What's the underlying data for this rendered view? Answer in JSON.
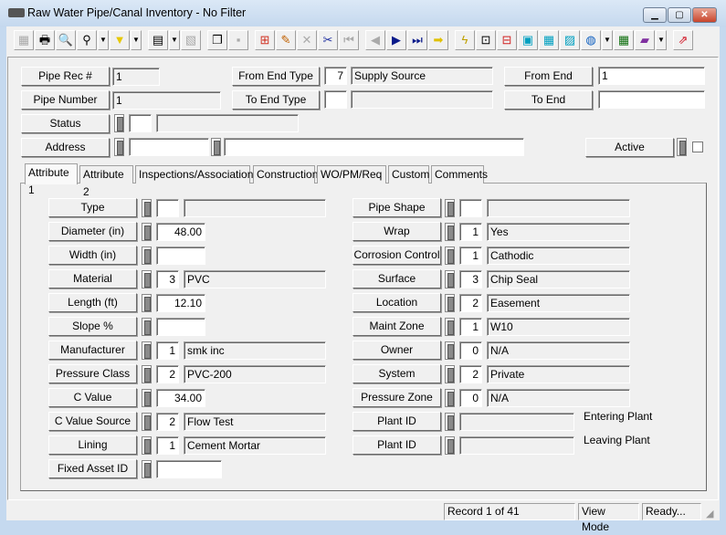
{
  "window": {
    "title": "Raw Water Pipe/Canal Inventory - No Filter",
    "minimize": "▁",
    "maximize": "▢",
    "close": "✕"
  },
  "toolbar": [
    {
      "name": "screen",
      "glyph": "▦",
      "disabled": true
    },
    {
      "name": "print",
      "glyph": "🖶"
    },
    {
      "name": "print-preview",
      "glyph": "🔍"
    },
    {
      "name": "find",
      "glyph": "⚲",
      "dd": true
    },
    {
      "name": "filter",
      "glyph": "▼",
      "color": "#e6c800",
      "dd": true
    },
    {
      "name": "report",
      "glyph": "▤",
      "dd": true
    },
    {
      "name": "form",
      "glyph": "▧",
      "disabled": true
    },
    {
      "name": "copy-record",
      "glyph": "❐"
    },
    {
      "name": "save",
      "glyph": "▪",
      "disabled": true
    },
    {
      "name": "add-record",
      "glyph": "⊞",
      "color": "#d03020"
    },
    {
      "name": "edit",
      "glyph": "✎",
      "color": "#c06000"
    },
    {
      "name": "delete",
      "glyph": "✕",
      "disabled": true
    },
    {
      "name": "cut",
      "glyph": "✂",
      "color": "#2030a0"
    },
    {
      "name": "first-record",
      "glyph": "⏮",
      "disabled": true
    },
    {
      "name": "previous-record",
      "glyph": "◀",
      "disabled": true
    },
    {
      "name": "next-record",
      "glyph": "▶",
      "color": "#0a1a8a"
    },
    {
      "name": "last-record",
      "glyph": "⏭",
      "color": "#0a1a8a"
    },
    {
      "name": "go-to",
      "glyph": "➡",
      "color": "#e0c000"
    },
    {
      "name": "lightning",
      "glyph": "ϟ",
      "color": "#c0a000"
    },
    {
      "name": "diagram",
      "glyph": "⊡"
    },
    {
      "name": "network",
      "glyph": "⊟",
      "color": "#d02020"
    },
    {
      "name": "map",
      "glyph": "▣",
      "color": "#00a0c0"
    },
    {
      "name": "calculator",
      "glyph": "▦",
      "color": "#00a0c0"
    },
    {
      "name": "parcel-map",
      "glyph": "▨",
      "color": "#00a0c0"
    },
    {
      "name": "globe",
      "glyph": "◍",
      "color": "#1060c0",
      "dd": true
    },
    {
      "name": "spreadsheet",
      "glyph": "▦",
      "color": "#107010"
    },
    {
      "name": "book",
      "glyph": "▰",
      "color": "#8030a0",
      "dd": true
    },
    {
      "name": "exit",
      "glyph": "⇗",
      "color": "#d01020"
    }
  ],
  "header": {
    "pipe_rec": {
      "label": "Pipe Rec #",
      "value": "1"
    },
    "pipe_number": {
      "label": "Pipe Number",
      "value": "1"
    },
    "status": {
      "label": "Status",
      "code": "",
      "desc": ""
    },
    "address": {
      "label": "Address",
      "number": "",
      "street": ""
    },
    "from_end_type": {
      "label": "From End Type",
      "code": "7",
      "desc": "Supply Source"
    },
    "to_end_type": {
      "label": "To End Type",
      "code": "",
      "desc": ""
    },
    "from_end": {
      "label": "From End",
      "value": "1"
    },
    "to_end": {
      "label": "To End",
      "value": ""
    },
    "active": {
      "label": "Active",
      "checked": false
    }
  },
  "tabs": [
    "Attribute 1",
    "Attribute 2",
    "Inspections/Associations",
    "Construction",
    "WO/PM/Req",
    "Custom",
    "Comments"
  ],
  "active_tab": "Attribute 1",
  "left_fields": [
    {
      "label": "Type",
      "kind": "lookup",
      "code": "",
      "desc": ""
    },
    {
      "label": "Diameter (in)",
      "kind": "number",
      "value": "48.00"
    },
    {
      "label": "Width (in)",
      "kind": "number",
      "value": ""
    },
    {
      "label": "Material",
      "kind": "lookup",
      "code": "3",
      "desc": "PVC"
    },
    {
      "label": "Length (ft)",
      "kind": "number",
      "value": "12.10"
    },
    {
      "label": "Slope %",
      "kind": "number",
      "value": ""
    },
    {
      "label": "Manufacturer",
      "kind": "lookup",
      "code": "1",
      "desc": "smk inc"
    },
    {
      "label": "Pressure Class",
      "kind": "lookup",
      "code": "2",
      "desc": "PVC-200"
    },
    {
      "label": "C Value",
      "kind": "number",
      "value": "34.00"
    },
    {
      "label": "C Value Source",
      "kind": "lookup",
      "code": "2",
      "desc": "Flow Test"
    },
    {
      "label": "Lining",
      "kind": "lookup",
      "code": "1",
      "desc": "Cement Mortar"
    },
    {
      "label": "Fixed Asset ID",
      "kind": "text",
      "value": ""
    }
  ],
  "right_fields": [
    {
      "label": "Pipe Shape",
      "kind": "lookup",
      "code": "",
      "desc": ""
    },
    {
      "label": "Wrap",
      "kind": "lookup",
      "code": "1",
      "desc": "Yes"
    },
    {
      "label": "Corrosion Control",
      "kind": "lookup",
      "code": "1",
      "desc": "Cathodic"
    },
    {
      "label": "Surface",
      "kind": "lookup",
      "code": "3",
      "desc": "Chip Seal"
    },
    {
      "label": "Location",
      "kind": "lookup",
      "code": "2",
      "desc": "Easement"
    },
    {
      "label": "Maint Zone",
      "kind": "lookup",
      "code": "1",
      "desc": "W10"
    },
    {
      "label": "Owner",
      "kind": "lookup",
      "code": "0",
      "desc": "N/A"
    },
    {
      "label": "System",
      "kind": "lookup",
      "code": "2",
      "desc": "Private"
    },
    {
      "label": "Pressure Zone",
      "kind": "lookup",
      "code": "0",
      "desc": "N/A"
    },
    {
      "label": "Plant ID",
      "kind": "plant",
      "value": "",
      "note": "Entering Plant"
    },
    {
      "label": "Plant ID",
      "kind": "plant",
      "value": "",
      "note": "Leaving Plant"
    }
  ],
  "statusbar": {
    "record": "Record 1 of 41",
    "mode": "View Mode",
    "status": "Ready..."
  }
}
